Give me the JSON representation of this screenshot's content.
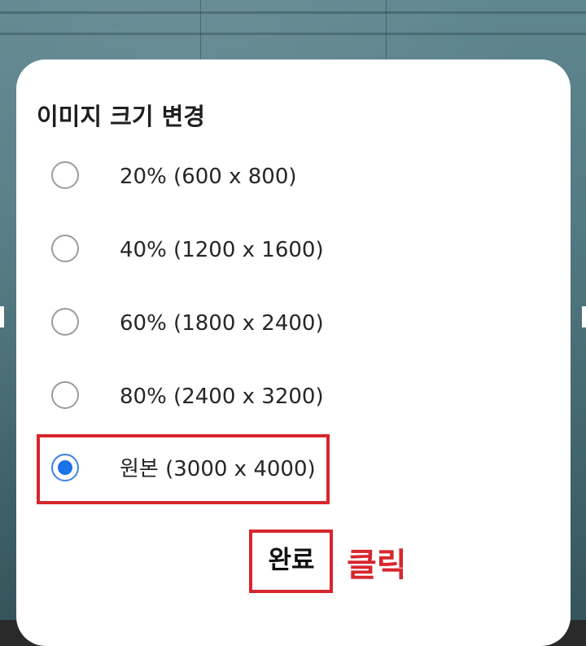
{
  "dialog": {
    "title": "이미지 크기 변경",
    "options": [
      {
        "label": "20% (600 x 800)",
        "selected": false
      },
      {
        "label": "40% (1200 x 1600)",
        "selected": false
      },
      {
        "label": "60% (1800 x 2400)",
        "selected": false
      },
      {
        "label": "80% (2400 x 3200)",
        "selected": false
      },
      {
        "label": "원본 (3000 x 4000)",
        "selected": true
      }
    ],
    "done_label": "완료"
  },
  "annotation": {
    "click_note": "클릭",
    "color": "#d7262d"
  },
  "colors": {
    "radio_selected": "#1a73e8",
    "radio_unselected": "#9b9b9b",
    "dialog_background": "#ffffff"
  }
}
